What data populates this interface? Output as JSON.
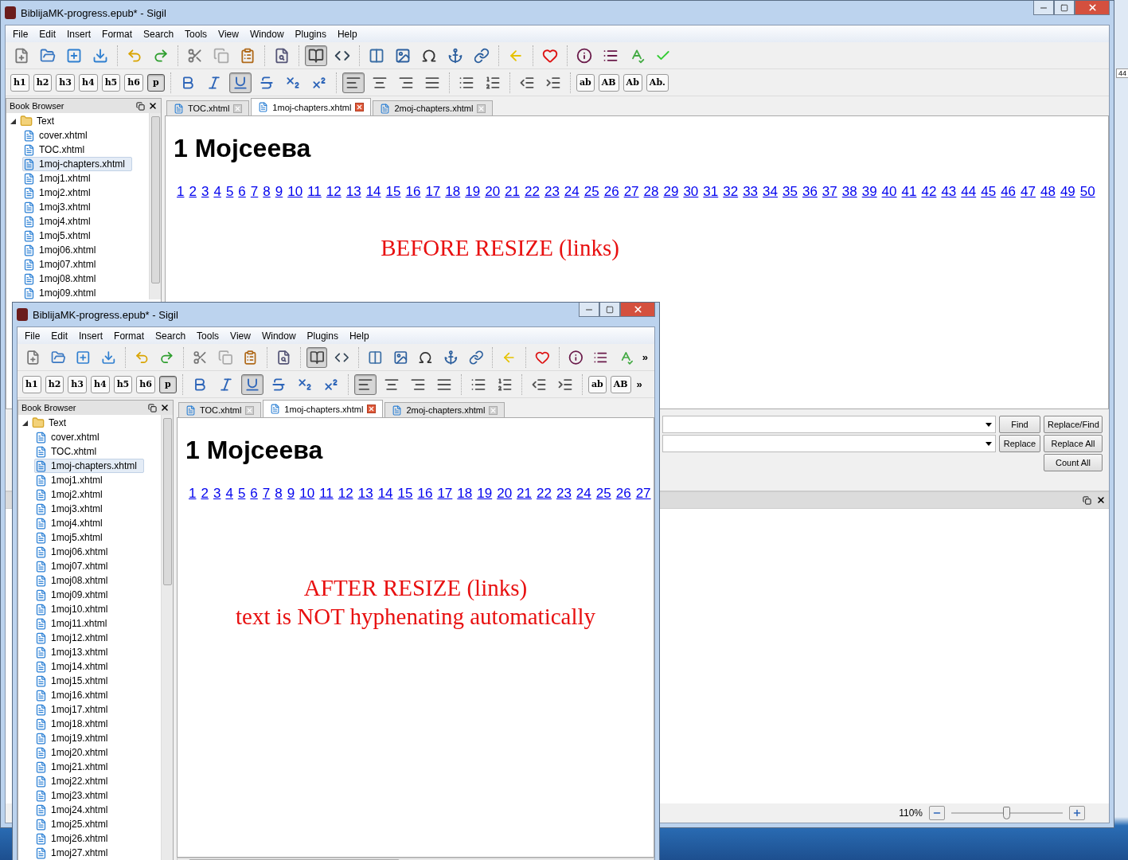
{
  "desktop": {
    "edge_text": "44"
  },
  "windows": [
    {
      "kind": "back",
      "title": "BiblijaMK-progress.epub* - Sigil",
      "menu": [
        "File",
        "Edit",
        "Insert",
        "Format",
        "Search",
        "Tools",
        "View",
        "Window",
        "Plugins",
        "Help"
      ],
      "main_toolbar": [
        {
          "kind": "icon",
          "pressed": false
        },
        {
          "kind": "icon",
          "pressed": false
        },
        {
          "kind": "icon",
          "pressed": false
        },
        {
          "kind": "icon",
          "pressed": false
        },
        {
          "kind": "separator"
        },
        {
          "kind": "icon",
          "pressed": false
        },
        {
          "kind": "icon",
          "pressed": false
        },
        {
          "kind": "separator"
        },
        {
          "kind": "icon",
          "pressed": false
        },
        {
          "kind": "icon",
          "pressed": false
        },
        {
          "kind": "icon",
          "pressed": false
        },
        {
          "kind": "separator"
        },
        {
          "kind": "icon",
          "pressed": false
        },
        {
          "kind": "separator"
        },
        {
          "kind": "icon",
          "pressed": true
        },
        {
          "kind": "icon",
          "pressed": false
        },
        {
          "kind": "separator"
        },
        {
          "kind": "icon",
          "pressed": false
        },
        {
          "kind": "icon",
          "pressed": false
        },
        {
          "kind": "icon",
          "pressed": false
        },
        {
          "kind": "icon",
          "pressed": false
        },
        {
          "kind": "icon",
          "pressed": false
        },
        {
          "kind": "separator"
        },
        {
          "kind": "icon",
          "pressed": false
        },
        {
          "kind": "separator"
        },
        {
          "kind": "icon",
          "pressed": false
        },
        {
          "kind": "separator"
        },
        {
          "kind": "icon",
          "pressed": false
        },
        {
          "kind": "icon",
          "pressed": false
        },
        {
          "kind": "icon",
          "pressed": false
        },
        {
          "kind": "icon",
          "pressed": false
        }
      ],
      "format_toolbar": [
        {
          "kind": "text",
          "label": "h1",
          "pressed": false
        },
        {
          "kind": "text",
          "label": "h2",
          "pressed": false
        },
        {
          "kind": "text",
          "label": "h3",
          "pressed": false
        },
        {
          "kind": "text",
          "label": "h4",
          "pressed": false
        },
        {
          "kind": "text",
          "label": "h5",
          "pressed": false
        },
        {
          "kind": "text",
          "label": "h6",
          "pressed": false
        },
        {
          "kind": "text",
          "label": "p",
          "pressed": true
        },
        {
          "kind": "separator"
        },
        {
          "kind": "icon",
          "pressed": false
        },
        {
          "kind": "icon",
          "pressed": false
        },
        {
          "kind": "icon",
          "pressed": true
        },
        {
          "kind": "icon",
          "pressed": false
        },
        {
          "kind": "icon",
          "pressed": false
        },
        {
          "kind": "icon",
          "pressed": false
        },
        {
          "kind": "separator"
        },
        {
          "kind": "icon",
          "pressed": true
        },
        {
          "kind": "icon",
          "pressed": false
        },
        {
          "kind": "icon",
          "pressed": false
        },
        {
          "kind": "icon",
          "pressed": false
        },
        {
          "kind": "separator"
        },
        {
          "kind": "icon",
          "pressed": false
        },
        {
          "kind": "icon",
          "pressed": false
        },
        {
          "kind": "separator"
        },
        {
          "kind": "icon",
          "pressed": false
        },
        {
          "kind": "icon",
          "pressed": false
        },
        {
          "kind": "separator"
        },
        {
          "kind": "text",
          "label": "ab",
          "pressed": false
        },
        {
          "kind": "text",
          "label": "AB",
          "pressed": false
        },
        {
          "kind": "text",
          "label": "Ab",
          "pressed": false
        },
        {
          "kind": "text",
          "label": "Ab.",
          "pressed": false
        }
      ],
      "book_browser": {
        "title": "Book Browser",
        "tree": {
          "label": "Text",
          "expanded": true,
          "children": [
            {
              "label": "cover.xhtml",
              "selected": false
            },
            {
              "label": "TOC.xhtml",
              "selected": false
            },
            {
              "label": "1moj-chapters.xhtml",
              "selected": true
            },
            {
              "label": "1moj1.xhtml",
              "selected": false
            },
            {
              "label": "1moj2.xhtml",
              "selected": false
            },
            {
              "label": "1moj3.xhtml",
              "selected": false
            },
            {
              "label": "1moj4.xhtml",
              "selected": false
            },
            {
              "label": "1moj5.xhtml",
              "selected": false
            },
            {
              "label": "1moj06.xhtml",
              "selected": false
            },
            {
              "label": "1moj07.xhtml",
              "selected": false
            },
            {
              "label": "1moj08.xhtml",
              "selected": false
            },
            {
              "label": "1moj09.xhtml",
              "selected": false
            }
          ]
        }
      },
      "tabs": [
        {
          "label": "TOC.xhtml",
          "selected": false
        },
        {
          "label": "1moj-chapters.xhtml",
          "selected": true
        },
        {
          "label": "2moj-chapters.xhtml",
          "selected": false
        }
      ],
      "document": {
        "heading": "1 Мојсеева",
        "links": [
          "1",
          "2",
          "3",
          "4",
          "5",
          "6",
          "7",
          "8",
          "9",
          "10",
          "11",
          "12",
          "13",
          "14",
          "15",
          "16",
          "17",
          "18",
          "19",
          "20",
          "21",
          "22",
          "23",
          "24",
          "25",
          "26",
          "27",
          "28",
          "29",
          "30",
          "31",
          "32",
          "33",
          "34",
          "35",
          "36",
          "37",
          "38",
          "39",
          "40",
          "41",
          "42",
          "43",
          "44",
          "45",
          "46",
          "47",
          "48",
          "49",
          "50"
        ],
        "note": [
          "BEFORE RESIZE (links)"
        ]
      },
      "find_panel": {
        "buttons": [
          "Find",
          "Replace/Find",
          "Replace",
          "Replace All",
          "Count All"
        ]
      },
      "status_bar": {
        "zoom": "110%",
        "zoom_slider": {
          "level": 0.5
        }
      }
    },
    {
      "kind": "front",
      "title": "BiblijaMK-progress.epub* - Sigil",
      "menu": [
        "File",
        "Edit",
        "Insert",
        "Format",
        "Search",
        "Tools",
        "View",
        "Window",
        "Plugins",
        "Help"
      ],
      "main_toolbar": [
        {
          "kind": "icon",
          "pressed": false
        },
        {
          "kind": "icon",
          "pressed": false
        },
        {
          "kind": "icon",
          "pressed": false
        },
        {
          "kind": "icon",
          "pressed": false
        },
        {
          "kind": "separator"
        },
        {
          "kind": "icon",
          "pressed": false
        },
        {
          "kind": "icon",
          "pressed": false
        },
        {
          "kind": "separator"
        },
        {
          "kind": "icon",
          "pressed": false
        },
        {
          "kind": "icon",
          "pressed": false
        },
        {
          "kind": "icon",
          "pressed": false
        },
        {
          "kind": "separator"
        },
        {
          "kind": "icon",
          "pressed": false
        },
        {
          "kind": "separator"
        },
        {
          "kind": "icon",
          "pressed": true
        },
        {
          "kind": "icon",
          "pressed": false
        },
        {
          "kind": "separator"
        },
        {
          "kind": "icon",
          "pressed": false
        },
        {
          "kind": "icon",
          "pressed": false
        },
        {
          "kind": "icon",
          "pressed": false
        },
        {
          "kind": "icon",
          "pressed": false
        },
        {
          "kind": "icon",
          "pressed": false
        },
        {
          "kind": "separator"
        },
        {
          "kind": "icon",
          "pressed": false
        },
        {
          "kind": "separator"
        },
        {
          "kind": "icon",
          "pressed": false
        },
        {
          "kind": "separator"
        },
        {
          "kind": "icon",
          "pressed": false
        },
        {
          "kind": "icon",
          "pressed": false
        },
        {
          "kind": "icon",
          "pressed": false
        },
        {
          "kind": "overflow",
          "label": "»"
        }
      ],
      "format_toolbar": [
        {
          "kind": "text",
          "label": "h1",
          "pressed": false
        },
        {
          "kind": "text",
          "label": "h2",
          "pressed": false
        },
        {
          "kind": "text",
          "label": "h3",
          "pressed": false
        },
        {
          "kind": "text",
          "label": "h4",
          "pressed": false
        },
        {
          "kind": "text",
          "label": "h5",
          "pressed": false
        },
        {
          "kind": "text",
          "label": "h6",
          "pressed": false
        },
        {
          "kind": "text",
          "label": "p",
          "pressed": true
        },
        {
          "kind": "separator"
        },
        {
          "kind": "icon",
          "pressed": false
        },
        {
          "kind": "icon",
          "pressed": false
        },
        {
          "kind": "icon",
          "pressed": true
        },
        {
          "kind": "icon",
          "pressed": false
        },
        {
          "kind": "icon",
          "pressed": false
        },
        {
          "kind": "icon",
          "pressed": false
        },
        {
          "kind": "separator"
        },
        {
          "kind": "icon",
          "pressed": true
        },
        {
          "kind": "icon",
          "pressed": false
        },
        {
          "kind": "icon",
          "pressed": false
        },
        {
          "kind": "icon",
          "pressed": false
        },
        {
          "kind": "separator"
        },
        {
          "kind": "icon",
          "pressed": false
        },
        {
          "kind": "icon",
          "pressed": false
        },
        {
          "kind": "separator"
        },
        {
          "kind": "icon",
          "pressed": false
        },
        {
          "kind": "icon",
          "pressed": false
        },
        {
          "kind": "separator"
        },
        {
          "kind": "text",
          "label": "ab",
          "pressed": false
        },
        {
          "kind": "text",
          "label": "AB",
          "pressed": false
        },
        {
          "kind": "overflow",
          "label": "»"
        }
      ],
      "book_browser": {
        "title": "Book Browser",
        "tree": {
          "label": "Text",
          "expanded": true,
          "children": [
            {
              "label": "cover.xhtml",
              "selected": false
            },
            {
              "label": "TOC.xhtml",
              "selected": false
            },
            {
              "label": "1moj-chapters.xhtml",
              "selected": true
            },
            {
              "label": "1moj1.xhtml",
              "selected": false
            },
            {
              "label": "1moj2.xhtml",
              "selected": false
            },
            {
              "label": "1moj3.xhtml",
              "selected": false
            },
            {
              "label": "1moj4.xhtml",
              "selected": false
            },
            {
              "label": "1moj5.xhtml",
              "selected": false
            },
            {
              "label": "1moj06.xhtml",
              "selected": false
            },
            {
              "label": "1moj07.xhtml",
              "selected": false
            },
            {
              "label": "1moj08.xhtml",
              "selected": false
            },
            {
              "label": "1moj09.xhtml",
              "selected": false
            },
            {
              "label": "1moj10.xhtml",
              "selected": false
            },
            {
              "label": "1moj11.xhtml",
              "selected": false
            },
            {
              "label": "1moj12.xhtml",
              "selected": false
            },
            {
              "label": "1moj13.xhtml",
              "selected": false
            },
            {
              "label": "1moj14.xhtml",
              "selected": false
            },
            {
              "label": "1moj15.xhtml",
              "selected": false
            },
            {
              "label": "1moj16.xhtml",
              "selected": false
            },
            {
              "label": "1moj17.xhtml",
              "selected": false
            },
            {
              "label": "1moj18.xhtml",
              "selected": false
            },
            {
              "label": "1moj19.xhtml",
              "selected": false
            },
            {
              "label": "1moj20.xhtml",
              "selected": false
            },
            {
              "label": "1moj21.xhtml",
              "selected": false
            },
            {
              "label": "1moj22.xhtml",
              "selected": false
            },
            {
              "label": "1moj23.xhtml",
              "selected": false
            },
            {
              "label": "1moj24.xhtml",
              "selected": false
            },
            {
              "label": "1moj25.xhtml",
              "selected": false
            },
            {
              "label": "1moj26.xhtml",
              "selected": false
            },
            {
              "label": "1moj27.xhtml",
              "selected": false
            }
          ]
        }
      },
      "tabs": [
        {
          "label": "TOC.xhtml",
          "selected": false
        },
        {
          "label": "1moj-chapters.xhtml",
          "selected": true
        },
        {
          "label": "2moj-chapters.xhtml",
          "selected": false
        }
      ],
      "document": {
        "heading": "1 Мојсеева",
        "links": [
          "1",
          "2",
          "3",
          "4",
          "5",
          "6",
          "7",
          "8",
          "9",
          "10",
          "11",
          "12",
          "13",
          "14",
          "15",
          "16",
          "17",
          "18",
          "19",
          "20",
          "21",
          "22",
          "23",
          "24",
          "25",
          "26",
          "27"
        ],
        "note": [
          "AFTER RESIZE (links)",
          "text is NOT hyphenating automatically"
        ]
      }
    }
  ]
}
